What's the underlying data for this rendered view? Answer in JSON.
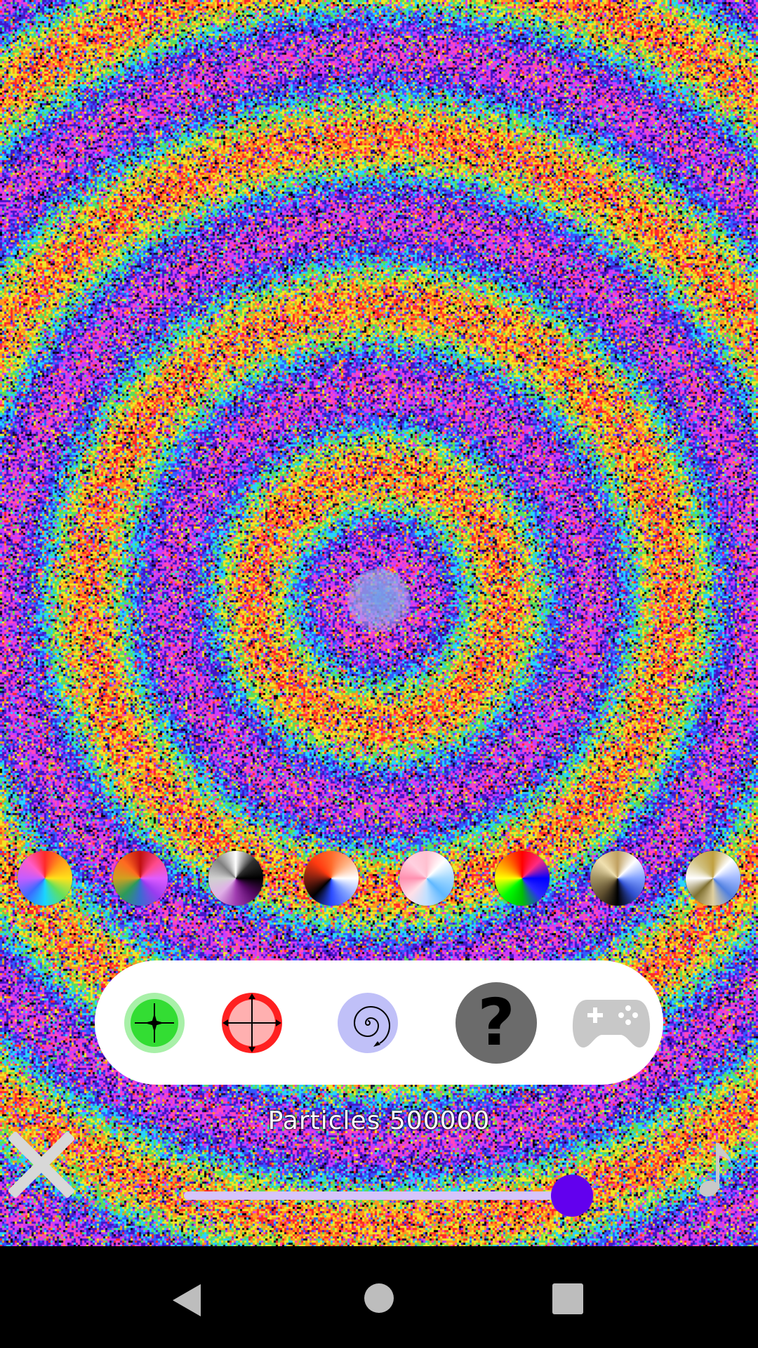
{
  "status": {
    "particles_label": "Particles 500000",
    "particle_count": 500000,
    "slider_fraction": 1.0
  },
  "colors": {
    "accent": "#6200ee",
    "slider_track": "#c9b3f7",
    "panel_bg": "#ffffff"
  },
  "palettes": [
    {
      "name": "rainbow-palette",
      "colors": [
        "#ff2a2a",
        "#ff9a1a",
        "#ffe21a",
        "#5fe05f",
        "#1ad5ff",
        "#3a6bff",
        "#c45cff",
        "#ff5cc8"
      ]
    },
    {
      "name": "warm-magenta-palette",
      "colors": [
        "#c01010",
        "#ff4a8a",
        "#e05cff",
        "#9a3cf0",
        "#3a6bd0",
        "#2a9a5a",
        "#d0a020",
        "#ff6a20"
      ]
    },
    {
      "name": "mono-purple-palette",
      "colors": [
        "#ffffff",
        "#303030",
        "#000000",
        "#5a0a6a",
        "#a03cb0",
        "#e0b0e8",
        "#d0d0d0",
        "#808080"
      ]
    },
    {
      "name": "fire-blue-palette",
      "colors": [
        "#ff6a2a",
        "#ffb080",
        "#ffffff",
        "#80a0ff",
        "#2a4aff",
        "#000000",
        "#802010",
        "#ff3a10"
      ]
    },
    {
      "name": "pastel-palette",
      "colors": [
        "#ffc0d0",
        "#ffffff",
        "#a0d8ff",
        "#60b8ff",
        "#c0e0ff",
        "#ffe0e8",
        "#ff90b0",
        "#ffd0e0"
      ]
    },
    {
      "name": "primary-palette",
      "colors": [
        "#ff0000",
        "#ff2a80",
        "#0000ff",
        "#2a2aff",
        "#00c000",
        "#00ff00",
        "#ffff00",
        "#ff8000"
      ]
    },
    {
      "name": "gold-blue-palette",
      "colors": [
        "#c0a060",
        "#ffffff",
        "#80a0ff",
        "#3050d0",
        "#000000",
        "#605030",
        "#a09060",
        "#f0e0b0"
      ]
    },
    {
      "name": "gold-white-palette",
      "colors": [
        "#c0a040",
        "#ffffff",
        "#a0b8ff",
        "#5080e0",
        "#e0d0a0",
        "#807030",
        "#ffffff",
        "#d0c080"
      ]
    }
  ],
  "tools": [
    {
      "name": "attract-tool-icon",
      "color": "#33dd33",
      "active": true
    },
    {
      "name": "repel-tool-icon",
      "color": "#ff2020",
      "active": false
    },
    {
      "name": "vortex-tool-icon",
      "color": "#c0c0f8",
      "active": false
    },
    {
      "name": "help-icon",
      "symbol": "?",
      "color": "#6b6b6b"
    },
    {
      "name": "gamepad-icon",
      "color": "#c8c8c8"
    }
  ],
  "icons": {
    "close": "close-icon",
    "music": "music-note-icon",
    "nav_back": "back-triangle-icon",
    "nav_home": "home-circle-icon",
    "nav_recents": "recents-square-icon"
  }
}
